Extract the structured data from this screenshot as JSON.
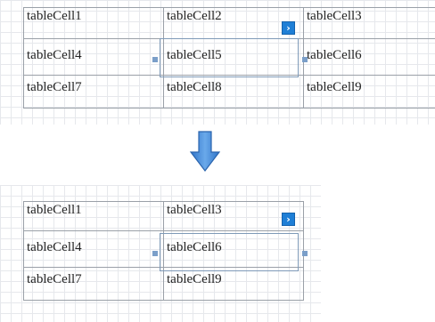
{
  "before": {
    "rows": [
      [
        "tableCell1",
        "tableCell2",
        "tableCell3"
      ],
      [
        "tableCell4",
        "tableCell5",
        "tableCell6"
      ],
      [
        "tableCell7",
        "tableCell8",
        "tableCell9"
      ]
    ],
    "selected_cell": "tableCell5",
    "smart_tag_glyph": "›"
  },
  "after": {
    "rows": [
      [
        "tableCell1",
        "tableCell3"
      ],
      [
        "tableCell4",
        "tableCell6"
      ],
      [
        "tableCell7",
        "tableCell9"
      ]
    ],
    "selected_cell": "tableCell6",
    "smart_tag_glyph": "›"
  },
  "arrow_icon": "down-arrow-icon",
  "colors": {
    "selection": "#7f9ab8",
    "handle": "#7b9fc9",
    "smart_tag": "#1f7fd6",
    "arrow": "#4a8fd8",
    "grid": "#e6e8ec"
  }
}
